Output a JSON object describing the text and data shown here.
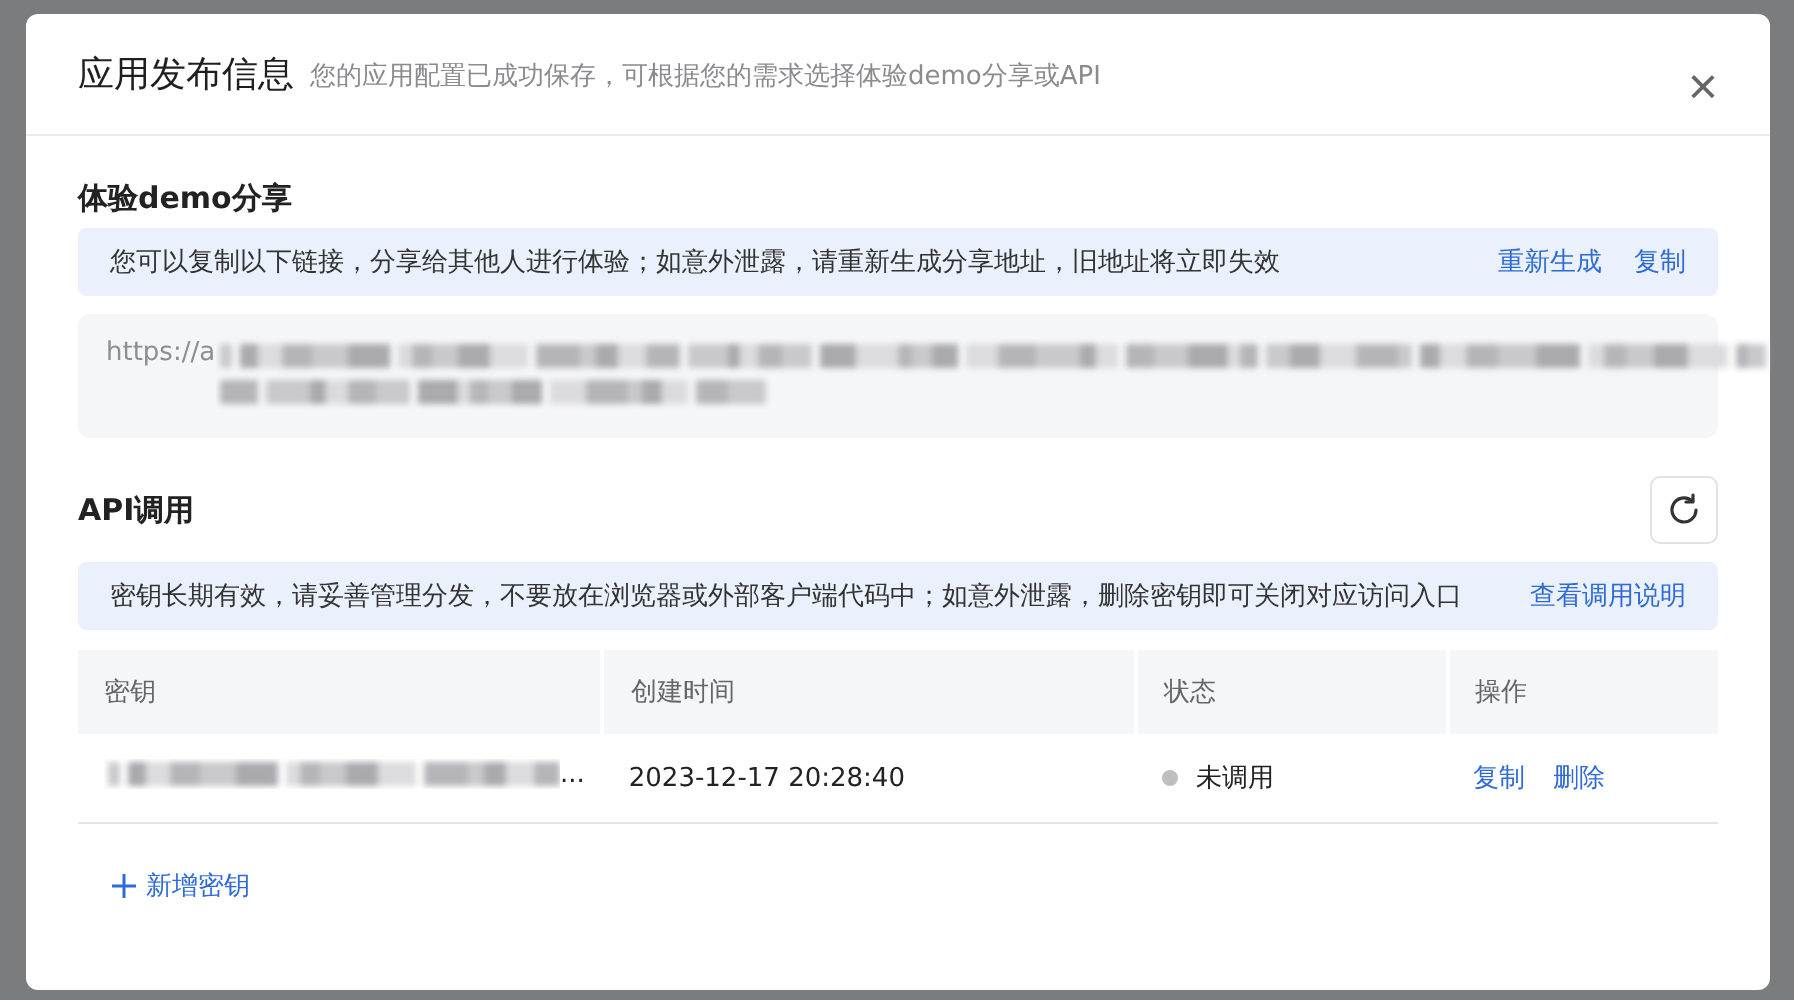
{
  "dialog": {
    "title": "应用发布信息",
    "subtitle": "您的应用配置已成功保存，可根据您的需求选择体验demo分享或API",
    "close": "×"
  },
  "demo_share": {
    "heading": "体验demo分享",
    "notice": "您可以复制以下链接，分享给其他人进行体验；如意外泄露，请重新生成分享地址，旧地址将立即失效",
    "actions": [
      "重新生成",
      "复制"
    ],
    "url_visible": "https://a"
  },
  "api": {
    "heading": "API调用",
    "notice": "密钥长期有效，请妥善管理分发，不要放在浏览器或外部客户端代码中；如意外泄露，删除密钥即可关闭对应访问入口",
    "notice_link": "查看调用说明",
    "table": {
      "columns": [
        "密钥",
        "创建时间",
        "状态",
        "操作"
      ],
      "rows": [
        {
          "key_tail": "...",
          "created": "2023-12-17 20:28:40",
          "status": "未调用",
          "color": "#bfbfbf",
          "actions": [
            "复制",
            "删除"
          ]
        }
      ]
    },
    "add_key": "新增密钥"
  }
}
